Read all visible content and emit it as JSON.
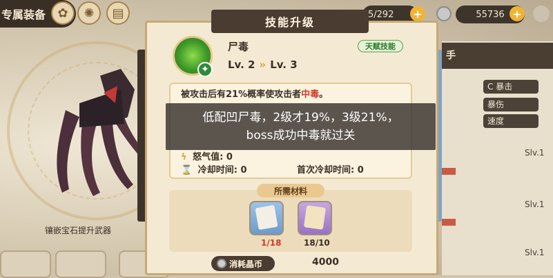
{
  "topbar": {
    "tab_label": "专属装备",
    "currency1": "5/292",
    "currency2": "55736"
  },
  "left": {
    "tip": "镶嵌宝石提升武器"
  },
  "right": {
    "header": "手",
    "stats": [
      "C 暴击",
      "暴伤",
      "速度"
    ],
    "slv": [
      "Slv.1",
      "Slv.1",
      "Slv.1"
    ]
  },
  "modal": {
    "title": "技能升级",
    "skill_name": "尸毒",
    "talent_tag": "天赋技能",
    "level_from": "Lv. 2",
    "level_arrow": "»",
    "level_to": "Lv. 3",
    "desc_prefix": "被攻击后有21%概率使攻击者",
    "desc_highlight": "中毒",
    "desc_suffix": "。",
    "rage_label": "怒气值:",
    "rage_value": "0",
    "cooldown_label": "冷却时间:",
    "cooldown_value": "0",
    "first_cd_label": "首次冷却时间:",
    "first_cd_value": "0",
    "materials_label": "所需材料",
    "materials": [
      {
        "name": "skill-book-blue",
        "count": "1/18",
        "color": "#d23a2a"
      },
      {
        "name": "skill-book-purple",
        "count": "18/10",
        "color": "#3a2f25"
      }
    ],
    "cost_label": "消耗晶币",
    "cost_value": "4000"
  },
  "overlay": {
    "line1": "低配凹尸毒，2级才19%，3级21%，",
    "line2": "boss成功中毒就过关"
  }
}
